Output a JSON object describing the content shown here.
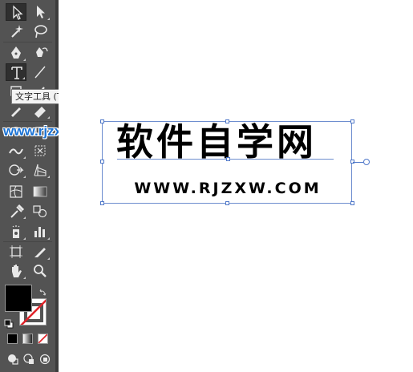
{
  "tooltip": {
    "text": "文字工具 (T)"
  },
  "watermark": {
    "text": "www.rjzxw.com"
  },
  "artboard": {
    "title_text": "软件自学网",
    "url_text": "WWW.RJZXW.COM"
  },
  "colors": {
    "toolbar_bg": "#535353",
    "selection_blue": "#4f78c9",
    "watermark_blue": "#1a73d6",
    "fill": "#000000",
    "stroke": "none"
  },
  "tools": [
    "selection-tool",
    "direct-selection-tool",
    "magic-wand-tool",
    "lasso-tool",
    "pen-tool",
    "curvature-tool",
    "type-tool",
    "line-segment-tool",
    "paintbrush-tool",
    "pencil-tool",
    "width-tool",
    "free-transform-tool",
    "shape-builder-tool",
    "perspective-grid-tool",
    "mesh-tool",
    "gradient-tool",
    "eyedropper-tool",
    "blend-tool",
    "symbol-sprayer-tool",
    "column-graph-tool",
    "artboard-tool",
    "slice-tool",
    "hand-tool",
    "zoom-tool"
  ]
}
